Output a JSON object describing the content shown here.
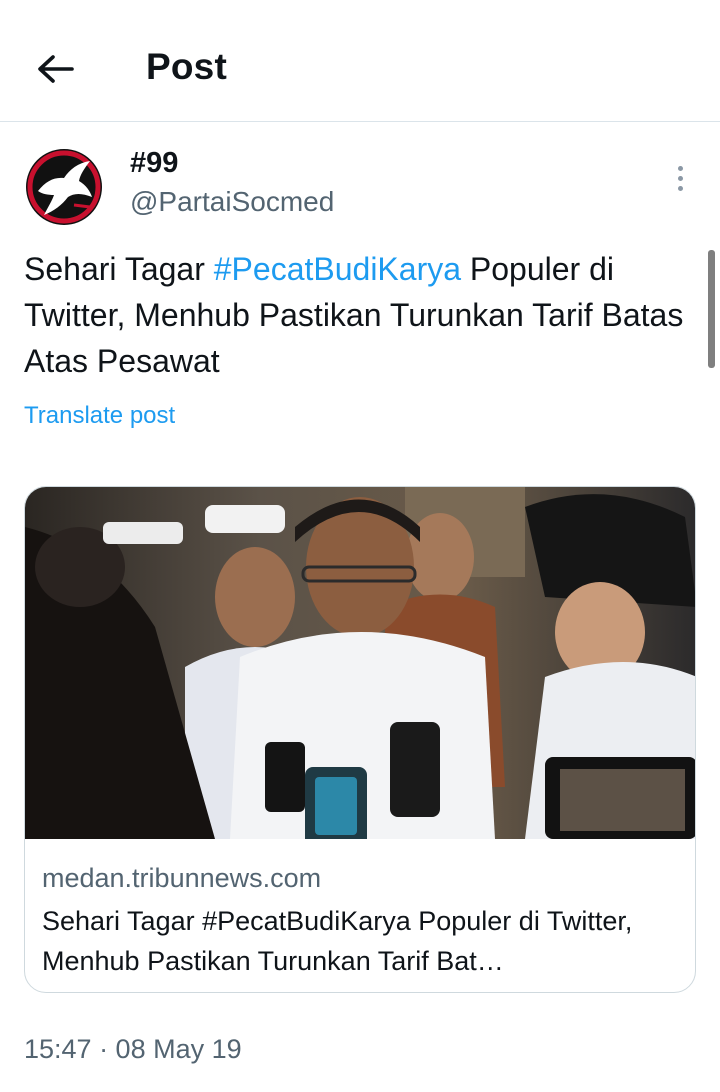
{
  "header": {
    "title": "Post",
    "back_icon": "arrow-left-icon"
  },
  "post": {
    "author": {
      "display_name": "#99",
      "handle": "@PartaiSocmed",
      "avatar": "party-logo-avatar"
    },
    "text": {
      "before": "Sehari Tagar ",
      "hashtag": "#PecatBudiKarya",
      "after": " Populer di Twitter, Menhub Pastikan Turunkan Tarif Batas Atas Pesawat"
    },
    "translate_label": "Translate post",
    "link_card": {
      "domain": "medan.tribunnews.com",
      "title": "Sehari Tagar #PecatBudiKarya Populer di Twitter, Menhub Pastikan Turunkan Tarif Bat…",
      "image": "press-photo"
    },
    "timestamp": "15:47 · 08 May 19"
  },
  "colors": {
    "accent": "#1d9bf0",
    "text_primary": "#0f1419",
    "text_secondary": "#536471",
    "border": "#cfd9de"
  }
}
